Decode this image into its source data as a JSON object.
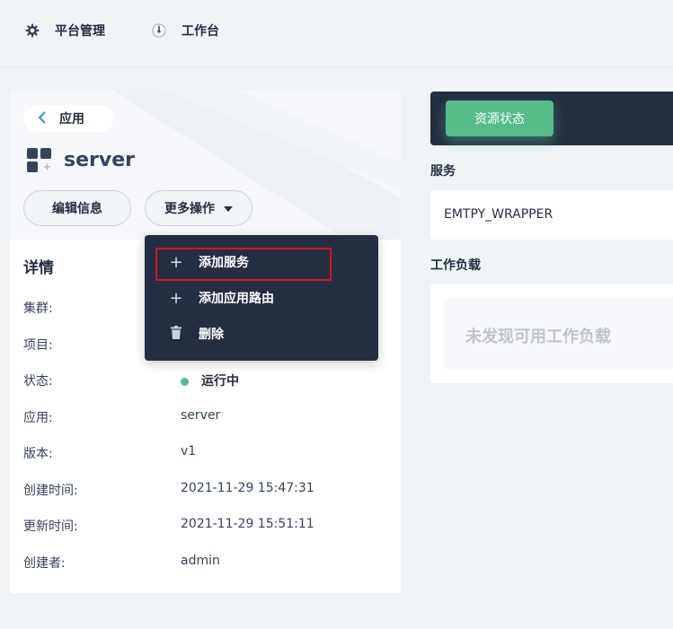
{
  "nav": {
    "platform_label": "平台管理",
    "workbench_label": "工作台",
    "platform_icon": "gear-icon",
    "workbench_icon": "dashboard-icon"
  },
  "app": {
    "back_label": "应用",
    "name": "server",
    "edit_button": "编辑信息",
    "more_button": "更多操作"
  },
  "details": {
    "title": "详情",
    "rows": [
      {
        "label": "集群:",
        "value": ""
      },
      {
        "label": "项目:",
        "value": ""
      },
      {
        "label": "状态:",
        "value": "运行中"
      },
      {
        "label": "应用:",
        "value": "server"
      },
      {
        "label": "版本:",
        "value": "v1"
      },
      {
        "label": "创建时间:",
        "value": "2021-11-29 15:47:31"
      },
      {
        "label": "更新时间:",
        "value": "2021-11-29 15:51:11"
      },
      {
        "label": "创建者:",
        "value": "admin"
      }
    ],
    "status_color": "#55bc8a"
  },
  "dropdown": {
    "items": [
      {
        "label": "添加服务",
        "icon": "plus-icon"
      },
      {
        "label": "添加应用路由",
        "icon": "plus-icon"
      },
      {
        "label": "删除",
        "icon": "trash-icon"
      }
    ],
    "highlight_color": "#d0171d"
  },
  "resources": {
    "tab_label": "资源状态",
    "services_title": "服务",
    "service_name": "EMTPY_WRAPPER",
    "workloads_title": "工作负载",
    "workloads_empty": "未发现可用工作负载"
  },
  "colors": {
    "accent": "#55bc8a",
    "dark": "#242e42",
    "background": "#eff4f9"
  }
}
